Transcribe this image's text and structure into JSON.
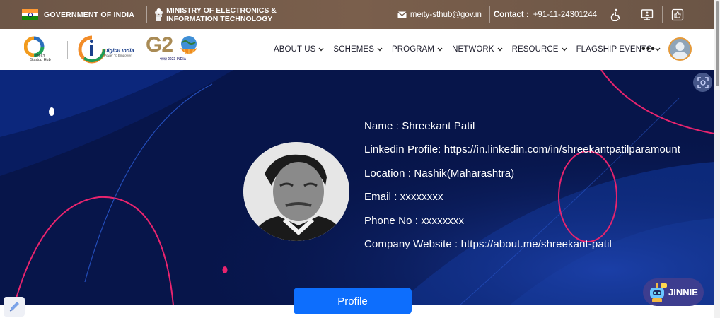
{
  "gov_bar": {
    "gov_label": "GOVERNMENT OF INDIA",
    "ministry_line1": "MINISTRY OF ELECTRONICS &",
    "ministry_line2": "INFORMATION TECHNOLOGY",
    "email": "meity-sthub@gov.in",
    "contact_label": "Contact :",
    "phone": "+91-11-24301244",
    "tools": [
      "accessibility-icon",
      "screen-reader-icon",
      "thumbs-up-icon"
    ]
  },
  "header": {
    "logos": {
      "meity_text_1": "MeitY",
      "meity_text_2": "Startup Hub",
      "digital_india": "Digital India",
      "digital_india_sub": "Power To Empower",
      "g20": "G2",
      "g20_sub": "भारत 2023 INDIA"
    },
    "nav": [
      {
        "label": "ABOUT US"
      },
      {
        "label": "SCHEMES"
      },
      {
        "label": "PROGRAM"
      },
      {
        "label": "NETWORK"
      },
      {
        "label": "RESOURCE"
      },
      {
        "label": "FLAGSHIP EVENTS"
      }
    ],
    "more": "•••"
  },
  "profile": {
    "name_line": "Name : Shreekant Patil",
    "linkedin_line": "Linkedin Profile: https://in.linkedin.com/in/shreekantpatilparamount",
    "location_line": "Location : Nashik(Maharashtra)",
    "email_line": "Email : xxxxxxxx",
    "phone_line": "Phone No : xxxxxxxx",
    "website_line": "Company Website : https://about.me/shreekant-patil",
    "button_label": "Profile"
  },
  "chatbot": {
    "label": "JINNIE"
  },
  "colors": {
    "gov_bar": "#6d5647",
    "hero_bg": "#07154a",
    "accent_pink": "#e8246e",
    "button_blue": "#0d6efd",
    "chatbot_bg": "#3d3d8f"
  }
}
